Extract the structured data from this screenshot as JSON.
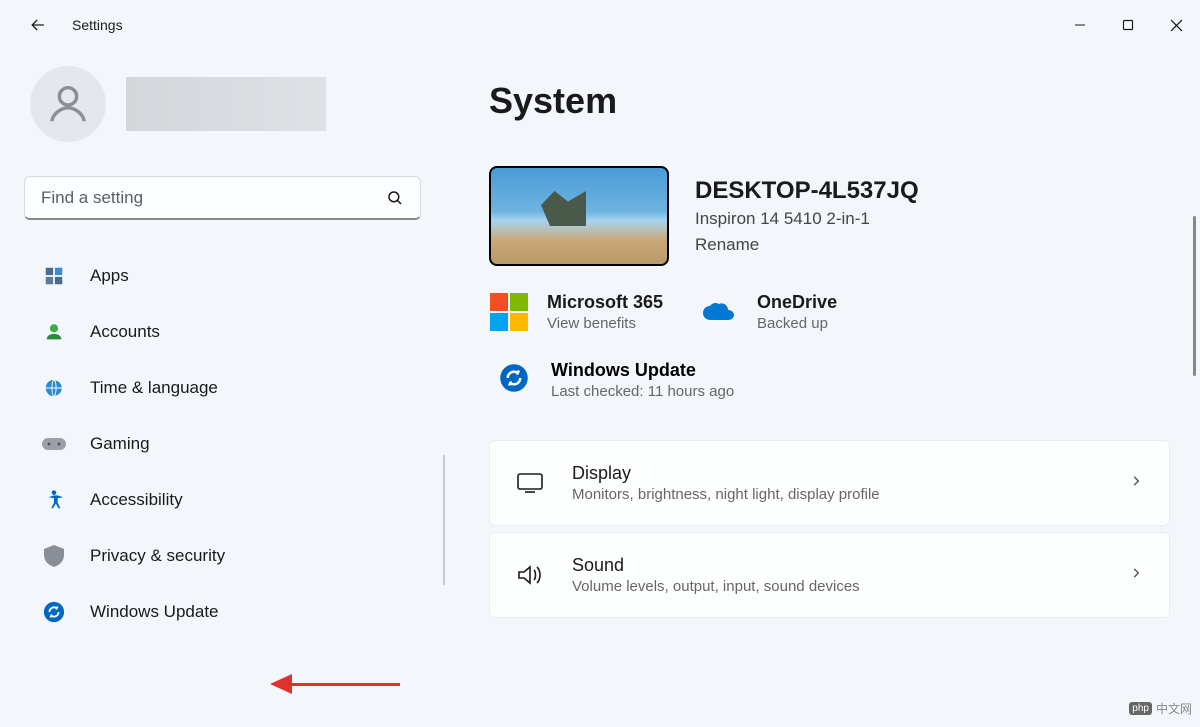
{
  "window": {
    "title": "Settings"
  },
  "search": {
    "placeholder": "Find a setting"
  },
  "nav": [
    {
      "key": "apps",
      "label": "Apps"
    },
    {
      "key": "accounts",
      "label": "Accounts"
    },
    {
      "key": "time-language",
      "label": "Time & language"
    },
    {
      "key": "gaming",
      "label": "Gaming"
    },
    {
      "key": "accessibility",
      "label": "Accessibility"
    },
    {
      "key": "privacy-security",
      "label": "Privacy & security"
    },
    {
      "key": "windows-update",
      "label": "Windows Update"
    }
  ],
  "page": {
    "title": "System",
    "device": {
      "name": "DESKTOP-4L537JQ",
      "model": "Inspiron 14 5410 2-in-1",
      "rename": "Rename"
    },
    "status": {
      "m365": {
        "title": "Microsoft 365",
        "sub": "View benefits"
      },
      "onedrive": {
        "title": "OneDrive",
        "sub": "Backed up"
      },
      "update": {
        "title": "Windows Update",
        "sub": "Last checked: 11 hours ago"
      }
    },
    "settings": [
      {
        "key": "display",
        "title": "Display",
        "sub": "Monitors, brightness, night light, display profile"
      },
      {
        "key": "sound",
        "title": "Sound",
        "sub": "Volume levels, output, input, sound devices"
      }
    ]
  },
  "watermark": "中文网"
}
